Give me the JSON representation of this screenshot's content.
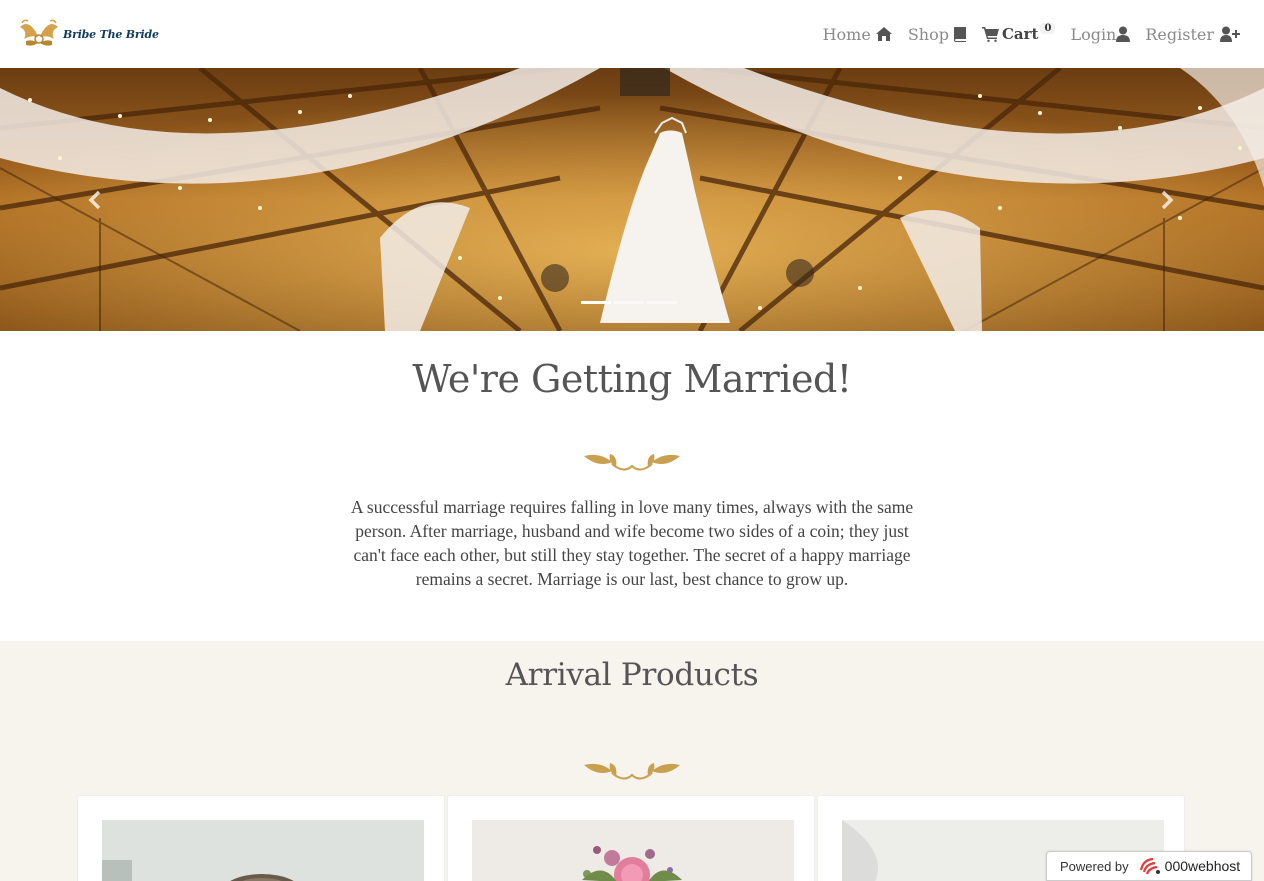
{
  "brand": {
    "name": "Bribe The Bride"
  },
  "nav": {
    "home": "Home",
    "shop": "Shop",
    "cart": "Cart",
    "cart_count": "0",
    "login": "Login",
    "register": "Register"
  },
  "carousel": {
    "slide_count": 3,
    "active_index": 0
  },
  "about": {
    "title": "We're Getting Married!",
    "text": "A successful marriage requires falling in love many times, always with the same person. After marriage, husband and wife become two sides of a coin; they just can't face each other, but still they stay together. The secret of a happy marriage remains a secret. Marriage is our last, best chance to grow up."
  },
  "products": {
    "title": "Arrival Products"
  },
  "footer_badge": {
    "label": "Powered by",
    "brand": "000webhost"
  },
  "colors": {
    "accent_gold": "#c9a04f",
    "text": "#555555",
    "products_bg": "#f7f4ee",
    "brand_blue": "#123a5f"
  },
  "icons": {
    "home": "home-icon",
    "shop": "book-icon",
    "cart": "cart-icon",
    "login": "user-icon",
    "register": "user-plus-icon"
  }
}
